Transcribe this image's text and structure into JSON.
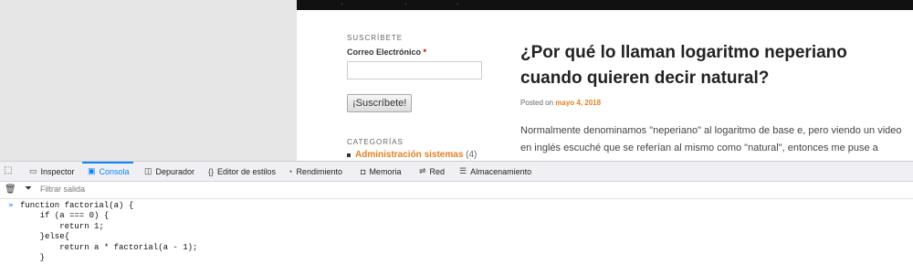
{
  "website": {
    "top_bar_text": ".",
    "sidebar": {
      "subscribe_title": "SUSCRÍBETE",
      "email_label": "Correo Electrónico",
      "required_mark": "*",
      "email_value": "",
      "subscribe_button": "¡Suscríbete!",
      "categories_title": "CATEGORÍAS",
      "categories": [
        {
          "label": "Administración sistemas",
          "count": "(4)"
        }
      ]
    },
    "article": {
      "title": "¿Por qué lo llaman logaritmo neperiano cuando quieren decir natural?",
      "posted_on_label": "Posted on",
      "date": "mayo 4, 2018",
      "paragraph": "Normalmente denominamos \"neperiano\" al logaritmo de base e, pero viendo un video en inglés escuché que se referían al mismo como \"natural\", entonces me puse a indagar"
    }
  },
  "devtools": {
    "tabs": [
      {
        "label": "Inspector",
        "icon": "inspector-icon"
      },
      {
        "label": "Consola",
        "icon": "console-icon",
        "active": true
      },
      {
        "label": "Depurador",
        "icon": "debugger-icon"
      },
      {
        "label": "Editor de estilos",
        "icon": "style-editor-icon"
      },
      {
        "label": "Rendimiento",
        "icon": "performance-icon"
      },
      {
        "label": "Memoria",
        "icon": "memory-icon"
      },
      {
        "label": "Red",
        "icon": "network-icon"
      },
      {
        "label": "Almacenamiento",
        "icon": "storage-icon"
      }
    ],
    "filter_placeholder": "Filtrar salida",
    "console_prompt": "»",
    "console_code": "function factorial(a) {\n    if (a === 0) {\n        return 1;\n    }else{\n        return a * factorial(a - 1);\n    }"
  }
}
